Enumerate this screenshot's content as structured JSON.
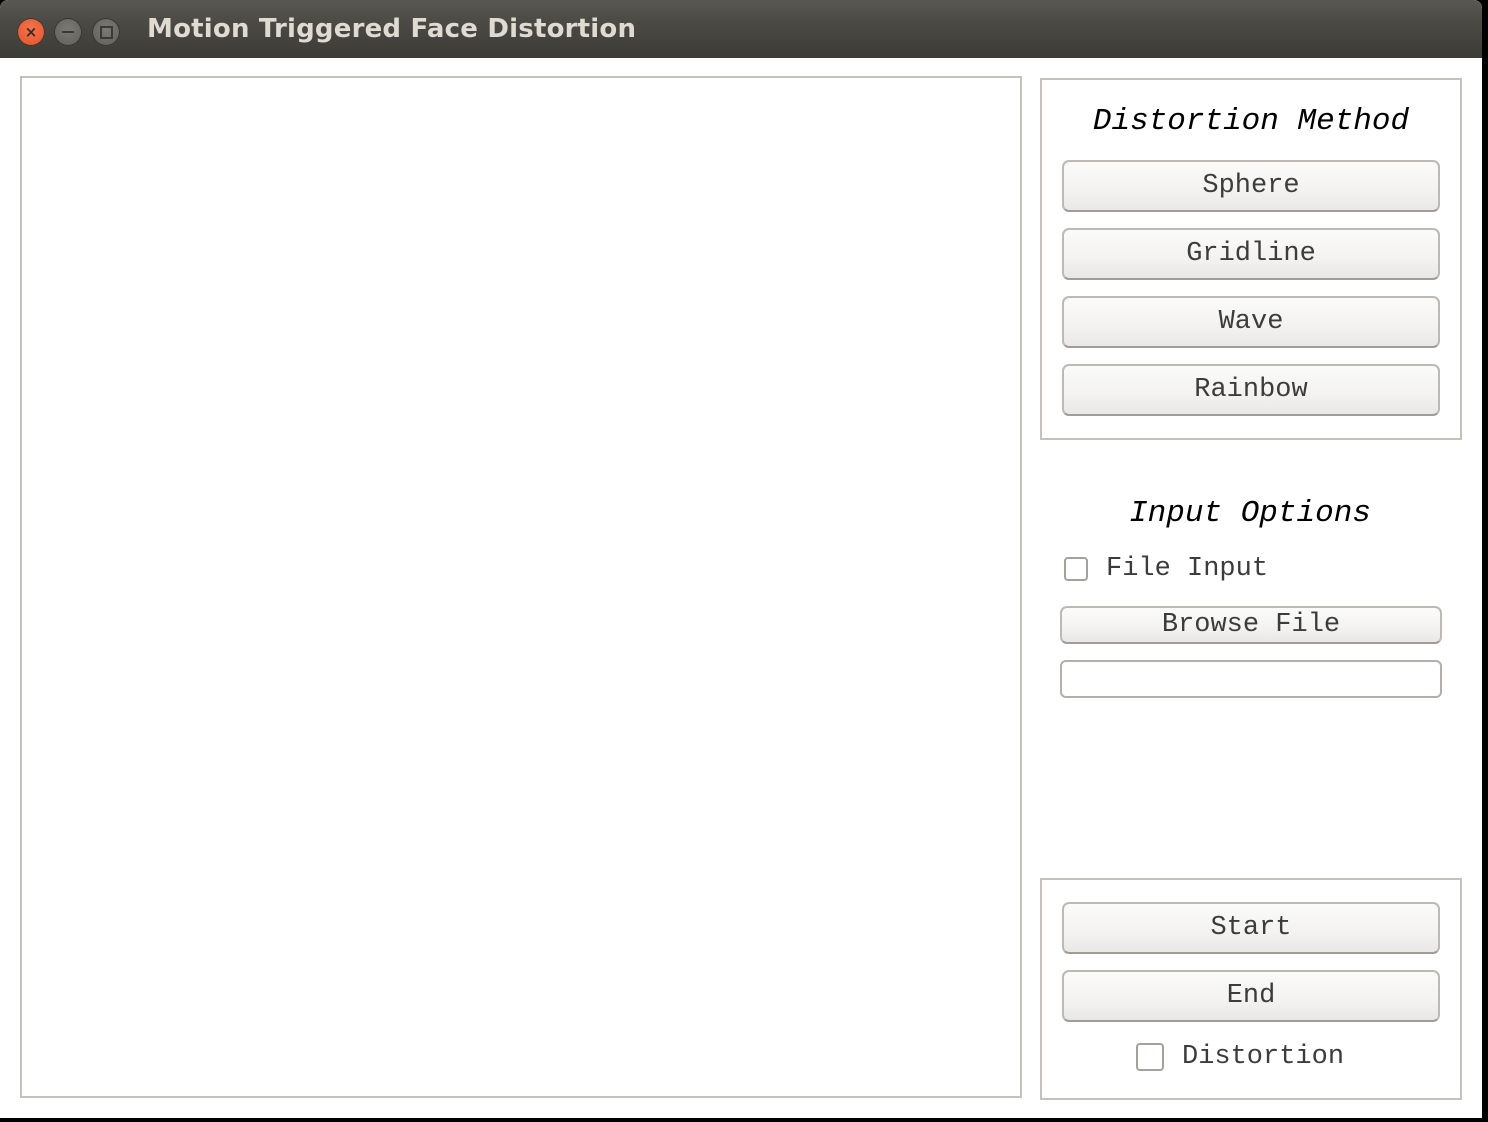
{
  "window": {
    "title": "Motion Triggered Face Distortion",
    "controls": {
      "close_icon": "close-icon",
      "minimize_icon": "minimize-icon",
      "maximize_icon": "maximize-icon"
    }
  },
  "distortion_method": {
    "heading": "Distortion Method",
    "buttons": [
      {
        "label": "Sphere"
      },
      {
        "label": "Gridline"
      },
      {
        "label": "Wave"
      },
      {
        "label": "Rainbow"
      }
    ]
  },
  "input_options": {
    "heading": "Input Options",
    "file_input_checkbox": {
      "label": "File Input",
      "checked": false
    },
    "browse_button": {
      "label": "Browse File"
    },
    "file_path_field": {
      "value": "",
      "placeholder": ""
    }
  },
  "controls": {
    "start_button": {
      "label": "Start"
    },
    "end_button": {
      "label": "End"
    },
    "distortion_checkbox": {
      "label": "Distortion",
      "checked": false
    }
  },
  "colors": {
    "titlebar": "#3c3b37",
    "close_button": "#e0512a",
    "border": "#c5c1bb",
    "title_text": "#dfdbd2"
  }
}
